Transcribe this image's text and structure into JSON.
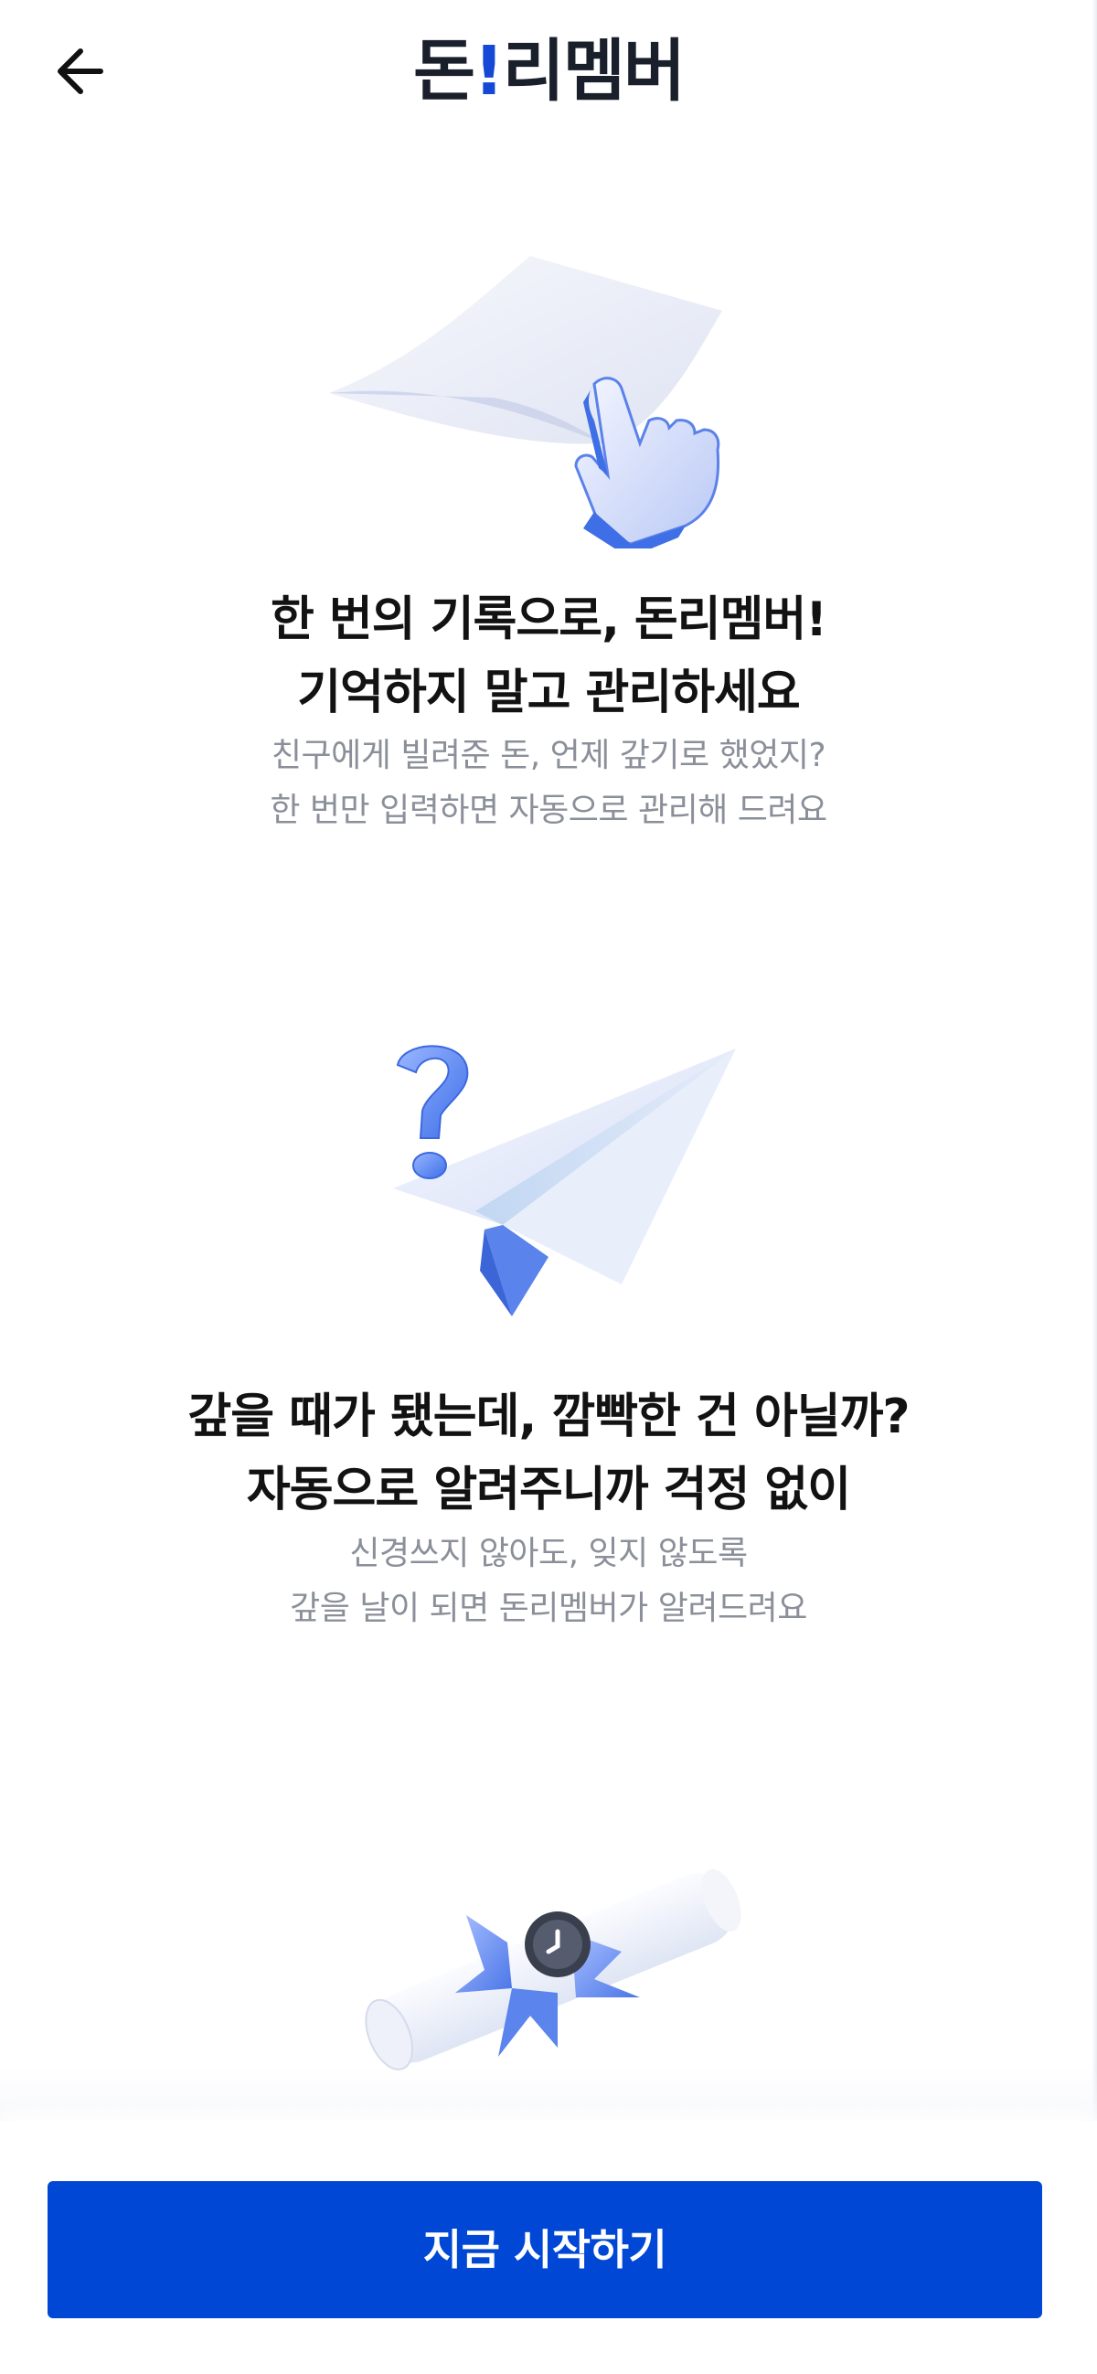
{
  "header": {
    "logo_part1": "돈",
    "logo_bang": "!",
    "logo_part2": "리멤버"
  },
  "sections": [
    {
      "headline_line1": "한 번의 기록으로, 돈리멤버!",
      "headline_line2": "기억하지 말고 관리하세요",
      "sub_line1": "친구에게 빌려준 돈, 언제 갚기로 했었지?",
      "sub_line2": "한 번만 입력하면 자동으로 관리해 드려요"
    },
    {
      "headline_line1": "갚을 때가 됐는데, 깜빡한 건 아닐까?",
      "headline_line2": "자동으로 알려주니까 걱정 없이",
      "sub_line1": "신경쓰지 않아도, 잊지 않도록",
      "sub_line2": "갚을 날이 되면 돈리멤버가 알려드려요"
    }
  ],
  "cta": {
    "label": "지금 시작하기"
  },
  "colors": {
    "accent": "#0047d6",
    "logo_bang": "#1648d6"
  }
}
